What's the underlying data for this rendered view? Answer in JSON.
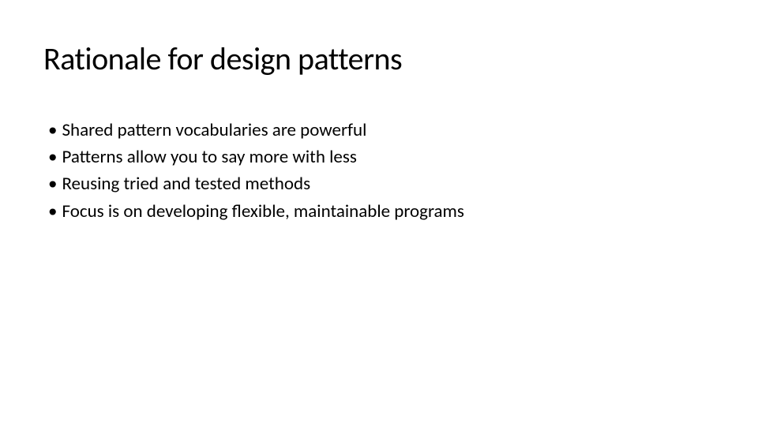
{
  "slide": {
    "title": "Rationale for design patterns",
    "bullets": [
      "Shared pattern vocabularies are powerful",
      "Patterns allow you to say more with less",
      "Reusing tried and tested methods",
      "Focus is on developing flexible, maintainable programs"
    ]
  }
}
